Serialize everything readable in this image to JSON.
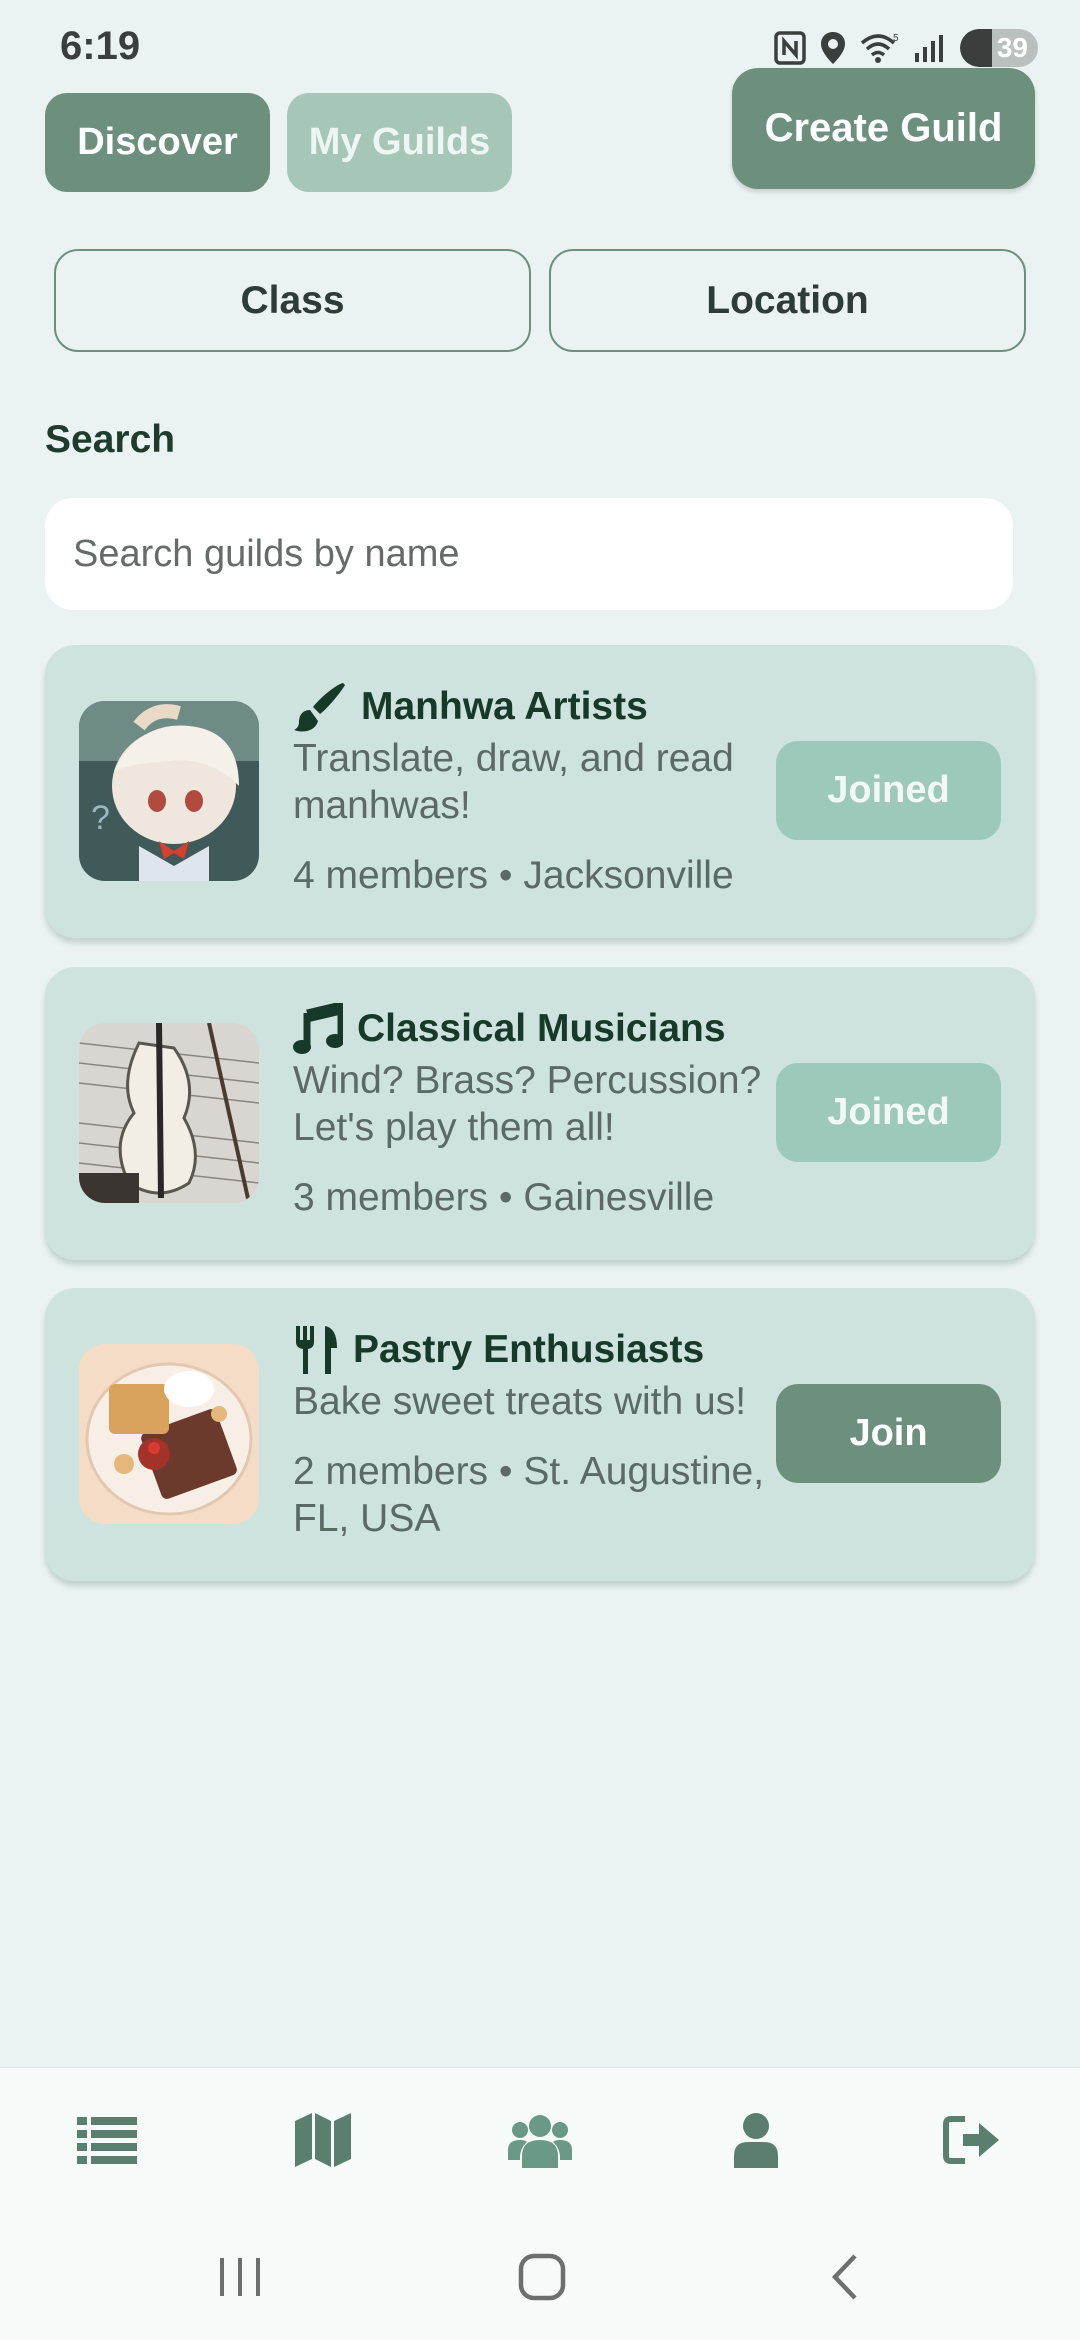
{
  "status_bar": {
    "time": "6:19",
    "battery": "39",
    "icons": [
      "nfc-icon",
      "location-icon",
      "wifi-icon",
      "signal-icon",
      "battery-icon"
    ]
  },
  "header": {
    "discover_label": "Discover",
    "my_guilds_label": "My Guilds",
    "create_guild_label": "Create Guild"
  },
  "filters": {
    "class_label": "Class",
    "location_label": "Location"
  },
  "search": {
    "label": "Search",
    "placeholder": "Search guilds by name",
    "value": ""
  },
  "guilds": [
    {
      "icon": "paintbrush-icon",
      "name": "Manhwa Artists",
      "description": "Translate, draw, and read manhwas!",
      "meta": "4 members • Jacksonville",
      "button_label": "Joined",
      "button_state": "joined",
      "thumbnail": "anime-character-image"
    },
    {
      "icon": "music-note-icon",
      "name": "Classical Musicians",
      "description": "Wind? Brass? Percussion? Let's play them all!",
      "meta": "3 members • Gainesville",
      "button_label": "Joined",
      "button_state": "joined",
      "thumbnail": "violin-image"
    },
    {
      "icon": "utensils-icon",
      "name": "Pastry Enthusiasts",
      "description": "Bake sweet treats with us!",
      "meta": "2 members • St. Augustine, FL, USA",
      "button_label": "Join",
      "button_state": "join",
      "thumbnail": "pastry-plate-image"
    }
  ],
  "bottom_nav": {
    "items": [
      "list-icon",
      "map-icon",
      "users-icon",
      "user-icon",
      "logout-icon"
    ],
    "active": "users-icon"
  },
  "colors": {
    "accent": "#6d907e",
    "accent_light": "#a6c6b8",
    "joined": "#9dc9bb",
    "card": "#cfe3de",
    "background": "#eaf3f2",
    "title_text": "#17392a"
  }
}
